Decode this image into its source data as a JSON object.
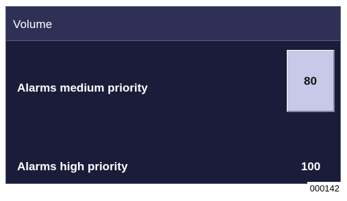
{
  "panel": {
    "title": "Volume"
  },
  "rows": [
    {
      "label": "Alarms medium priority",
      "value": "80"
    },
    {
      "label": "Alarms high priority",
      "value": "100"
    }
  ],
  "figure_id": "000142",
  "colors": {
    "panel_background": "#1b1c3a",
    "header_background": "#2e3155",
    "selected_value_background": "#c8c8e8",
    "text": "#ffffff"
  }
}
